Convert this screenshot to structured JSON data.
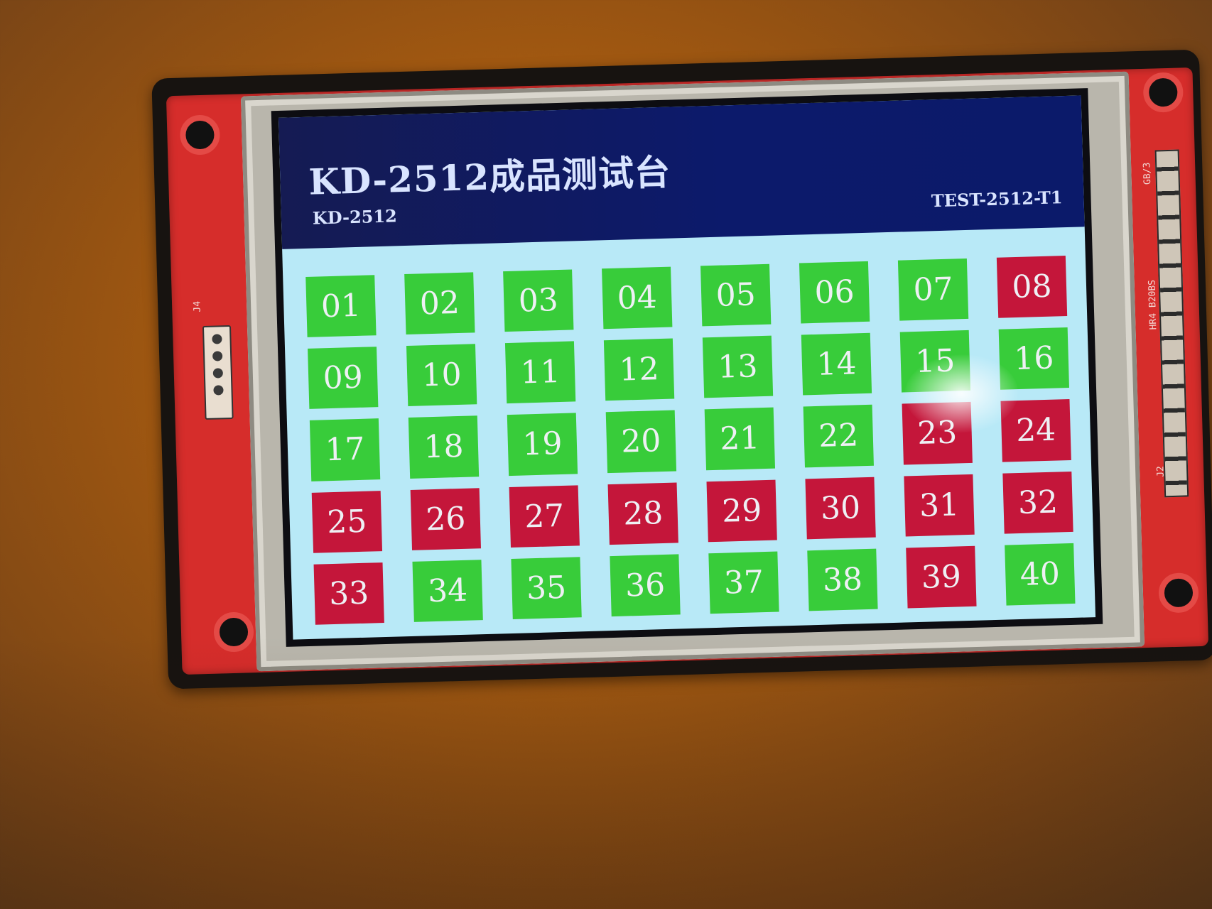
{
  "screen": {
    "title": "KD-2512成品测试台",
    "model_label": "KD-2512",
    "test_id": "TEST-2512-T1"
  },
  "board": {
    "silkscreen_left": "J4",
    "silkscreen_right_top": "GB/3",
    "silkscreen_right_mid": "HR4 B20BS",
    "silkscreen_right_bottom": "J2"
  },
  "colors": {
    "pass": "#38cc3a",
    "fail": "#c4163a",
    "header": "#0c1a6b",
    "panel_background": "#b8e9f7"
  },
  "stations": [
    {
      "label": "01",
      "status": "pass"
    },
    {
      "label": "02",
      "status": "pass"
    },
    {
      "label": "03",
      "status": "pass"
    },
    {
      "label": "04",
      "status": "pass"
    },
    {
      "label": "05",
      "status": "pass"
    },
    {
      "label": "06",
      "status": "pass"
    },
    {
      "label": "07",
      "status": "pass"
    },
    {
      "label": "08",
      "status": "fail"
    },
    {
      "label": "09",
      "status": "pass"
    },
    {
      "label": "10",
      "status": "pass"
    },
    {
      "label": "11",
      "status": "pass"
    },
    {
      "label": "12",
      "status": "pass"
    },
    {
      "label": "13",
      "status": "pass"
    },
    {
      "label": "14",
      "status": "pass"
    },
    {
      "label": "15",
      "status": "pass"
    },
    {
      "label": "16",
      "status": "pass"
    },
    {
      "label": "17",
      "status": "pass"
    },
    {
      "label": "18",
      "status": "pass"
    },
    {
      "label": "19",
      "status": "pass"
    },
    {
      "label": "20",
      "status": "pass"
    },
    {
      "label": "21",
      "status": "pass"
    },
    {
      "label": "22",
      "status": "pass"
    },
    {
      "label": "23",
      "status": "fail"
    },
    {
      "label": "24",
      "status": "fail"
    },
    {
      "label": "25",
      "status": "fail"
    },
    {
      "label": "26",
      "status": "fail"
    },
    {
      "label": "27",
      "status": "fail"
    },
    {
      "label": "28",
      "status": "fail"
    },
    {
      "label": "29",
      "status": "fail"
    },
    {
      "label": "30",
      "status": "fail"
    },
    {
      "label": "31",
      "status": "fail"
    },
    {
      "label": "32",
      "status": "fail"
    },
    {
      "label": "33",
      "status": "fail"
    },
    {
      "label": "34",
      "status": "pass"
    },
    {
      "label": "35",
      "status": "pass"
    },
    {
      "label": "36",
      "status": "pass"
    },
    {
      "label": "37",
      "status": "pass"
    },
    {
      "label": "38",
      "status": "pass"
    },
    {
      "label": "39",
      "status": "fail"
    },
    {
      "label": "40",
      "status": "pass"
    }
  ]
}
